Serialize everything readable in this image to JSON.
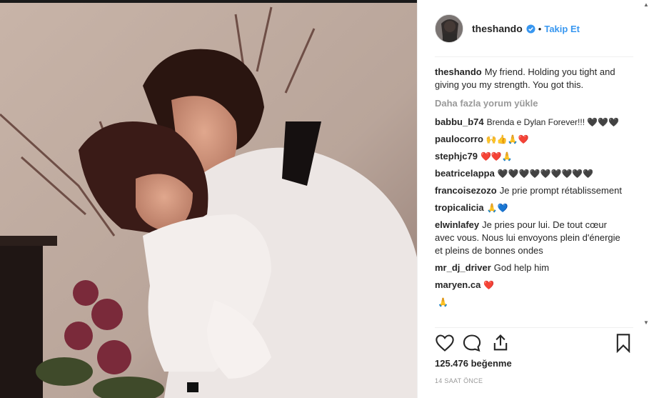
{
  "post": {
    "username": "theshando",
    "follow_label": "Takip Et",
    "dot": "•",
    "caption_user": "theshando",
    "caption_text": "My friend. Holding you tight and giving you my strength. You got this.",
    "load_more": "Daha fazla yorum yükle",
    "likes": "125.476 beğenme",
    "time": "14 SAAT ÖNCE",
    "image_alt": "Photo of a couple embracing"
  },
  "comments": [
    {
      "user": "babbu_b74",
      "text": "Brenda e Dylan Forever!!! 🖤🖤🖤"
    },
    {
      "user": "paulocorro",
      "text": "🙌👍🙏❤️"
    },
    {
      "user": "stephjc79",
      "text": "❤️❤️🙏"
    },
    {
      "user": "beatricelappa",
      "text": "🖤🖤🖤🖤🖤🖤🖤🖤🖤"
    },
    {
      "user": "francoisezozo",
      "text": "Je prie prompt rétablissement"
    },
    {
      "user": "tropicalicia",
      "text": "🙏💙"
    },
    {
      "user": "elwinlafey",
      "text": "Je pries pour lui. De tout cœur avec vous. Nous lui envoyons plein d'énergie et pleins de bonnes ondes"
    },
    {
      "user": "mr_dj_driver",
      "text": "God help him"
    },
    {
      "user": "maryen.ca",
      "text": "❤️"
    },
    {
      "user": "",
      "text": "🙏"
    }
  ],
  "icons": {
    "like": "heart-icon",
    "comment": "comment-icon",
    "share": "share-icon",
    "save": "bookmark-icon",
    "verified": "verified-badge-icon"
  },
  "colors": {
    "accent": "#3897f0",
    "text": "#262626",
    "muted": "#999999",
    "border": "#efefef"
  }
}
